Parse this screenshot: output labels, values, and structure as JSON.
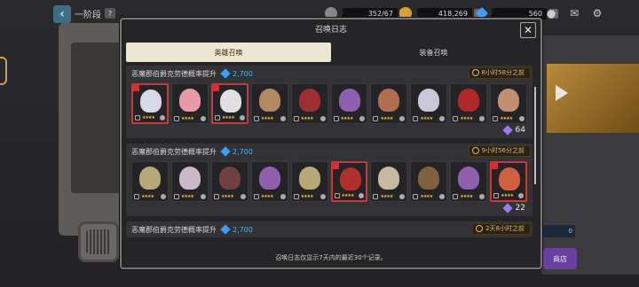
{
  "topbar": {
    "title": "一阶段",
    "help": "?",
    "res1": "352/67",
    "res2": "418,269",
    "res3": "560",
    "plus": "+"
  },
  "dialog": {
    "title": "召唤日志",
    "close": "✕",
    "tabs": [
      {
        "label": "英雄召唤"
      },
      {
        "label": "装备召唤"
      }
    ],
    "entries": [
      {
        "name": "恶魔郡伯爵克劳德概率提升",
        "cost": "2,700",
        "time": "8小时58分之前",
        "total": "64",
        "heroes": [
          {
            "rare": true,
            "color": "#d8d8e8"
          },
          {
            "rare": false,
            "color": "#e89aa8"
          },
          {
            "rare": true,
            "color": "#e0e0e0"
          },
          {
            "rare": false,
            "color": "#b48860"
          },
          {
            "rare": false,
            "color": "#a03030"
          },
          {
            "rare": false,
            "color": "#9060b0"
          },
          {
            "rare": false,
            "color": "#b07050"
          },
          {
            "rare": false,
            "color": "#c8c8d8"
          },
          {
            "rare": false,
            "color": "#b02828"
          },
          {
            "rare": false,
            "color": "#c09070"
          }
        ]
      },
      {
        "name": "恶魔郡伯爵克劳德概率提升",
        "cost": "2,700",
        "time": "9小时56分之前",
        "total": "22",
        "heroes": [
          {
            "rare": false,
            "color": "#b8a878"
          },
          {
            "rare": false,
            "color": "#c8b8c8"
          },
          {
            "rare": false,
            "color": "#704040"
          },
          {
            "rare": false,
            "color": "#9060b0"
          },
          {
            "rare": false,
            "color": "#b8a878"
          },
          {
            "rare": true,
            "color": "#b03030"
          },
          {
            "rare": false,
            "color": "#c8b8a0"
          },
          {
            "rare": false,
            "color": "#806040"
          },
          {
            "rare": false,
            "color": "#9060b0"
          },
          {
            "rare": true,
            "color": "#d06040"
          }
        ]
      },
      {
        "name": "恶魔郡伯爵克劳德概率提升",
        "cost": "2,700",
        "time": "2天8小时之前",
        "total": "",
        "heroes": []
      }
    ],
    "footer": "召唤日志仅显示7天内的最近30个记录。"
  },
  "background": {
    "bar_value": "0",
    "purple_btn": "商店"
  }
}
